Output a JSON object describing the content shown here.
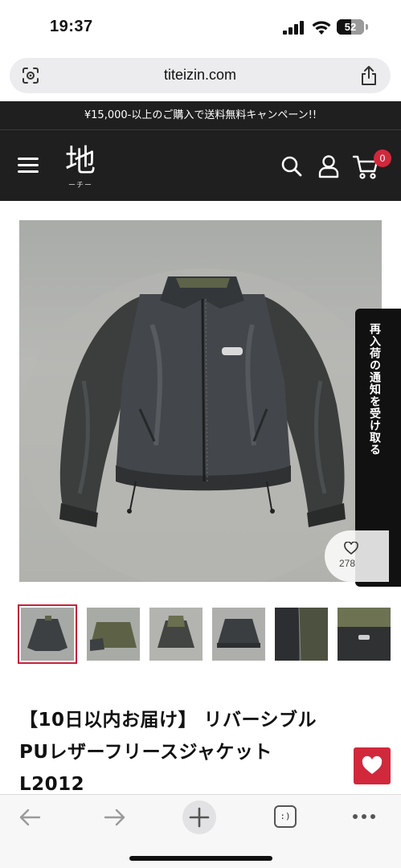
{
  "status_bar": {
    "time": "19:37",
    "battery": "52",
    "icons": [
      "signal-icon",
      "wifi-icon",
      "battery-icon"
    ]
  },
  "browser": {
    "url": "titeizin.com",
    "icons": [
      "page-settings-icon",
      "share-icon"
    ]
  },
  "promo_banner": "¥15,000-以上のご購入で送料無料キャンペーン!!",
  "header": {
    "logo_kanji": "地",
    "logo_sub": "ーチー",
    "cart_count": "0",
    "icons": [
      "menu-icon",
      "search-icon",
      "account-icon",
      "cart-icon"
    ]
  },
  "restock_tab": "再入荷の通知を受け取る",
  "wishlist": {
    "count": "278"
  },
  "thumbnails_count": 6,
  "product": {
    "title_lines": [
      "【10日以内お届け】 リバーシブル",
      "PUレザーフリースジャケット",
      "L2012"
    ]
  },
  "toolbar": {
    "icons": [
      "back-icon",
      "forward-icon",
      "new-tab-icon",
      "tabs-icon",
      "more-icon"
    ],
    "tabs_label": ":)"
  },
  "colors": {
    "header_bg": "#1f1f1f",
    "accent": "#d1283c",
    "thumb_active": "#c4223a"
  }
}
